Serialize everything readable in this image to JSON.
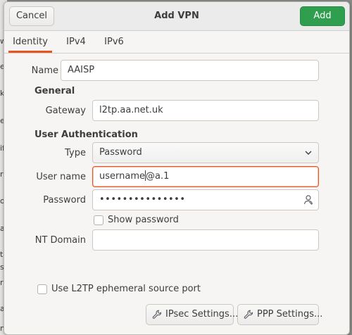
{
  "background_fragments": [
    "w",
    "et",
    "k",
    "e",
    "if",
    "ro",
    "ol",
    "a",
    "ti",
    "s",
    "ri",
    "a",
    "n"
  ],
  "header": {
    "title": "Add VPN",
    "cancel_label": "Cancel",
    "add_label": "Add",
    "add_color": "#2f9e4f"
  },
  "tabs": [
    {
      "label": "Identity",
      "active": true
    },
    {
      "label": "IPv4",
      "active": false
    },
    {
      "label": "IPv6",
      "active": false
    }
  ],
  "accent_color": "#e95420",
  "identity": {
    "name_label": "Name",
    "name_value": "AAISP",
    "general_heading": "General",
    "gateway_label": "Gateway",
    "gateway_value": "l2tp.aa.net.uk",
    "auth_heading": "User Authentication",
    "type_label": "Type",
    "type_value": "Password",
    "username_label": "User name",
    "username_before_cursor": "username",
    "username_after_cursor": "@a.1",
    "password_label": "Password",
    "password_masked": "•••••••••••••••",
    "show_password_label": "Show password",
    "show_password_checked": false,
    "nt_domain_label": "NT Domain",
    "nt_domain_value": ""
  },
  "ephemeral": {
    "label": "Use L2TP ephemeral source port",
    "checked": false
  },
  "buttons": {
    "ipsec_label": "IPsec Settings...",
    "ppp_label": "PPP Settings..."
  },
  "icons": {
    "password_field": "user-secret-icon",
    "dropdown": "chevron-down-icon",
    "settings_buttons": "wrench-icon"
  }
}
